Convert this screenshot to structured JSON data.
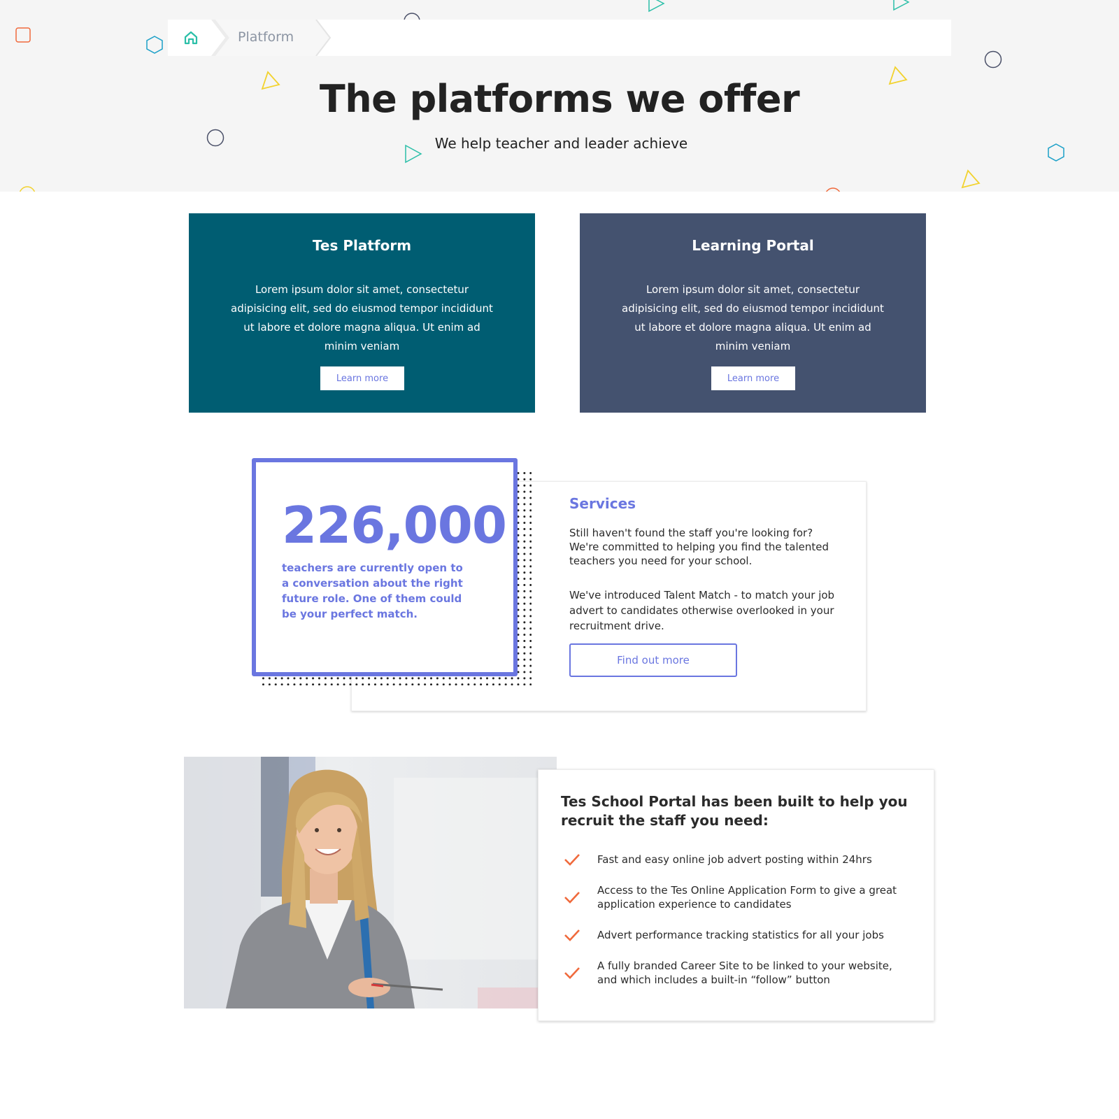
{
  "breadcrumb": {
    "home_icon": "home-icon",
    "current": "Platform"
  },
  "hero": {
    "title": "The platforms we offer",
    "subtitle": "We help teacher and leader achieve"
  },
  "platforms": [
    {
      "title": "Tes Platform",
      "description": "Lorem ipsum dolor sit amet, consectetur adipisicing elit, sed do eiusmod tempor incididunt ut labore et dolore magna aliqua. Ut enim ad minim veniam",
      "button": "Learn more",
      "color": "#005d72"
    },
    {
      "title": "Learning Portal",
      "description": "Lorem ipsum dolor sit amet, consectetur adipisicing elit, sed do eiusmod tempor incididunt ut labore et dolore magna aliqua. Ut enim ad minim veniam",
      "button": "Learn more",
      "color": "#44526f"
    }
  ],
  "stat": {
    "number": "226,000",
    "text": "teachers are currently open to a conversation about the right future role. One of them could be your perfect match."
  },
  "services": {
    "title": "Services",
    "paragraph1": "Still haven't found the staff you're looking for? We're committed to helping you find the talented teachers you need for your school.",
    "paragraph2": "We've introduced Talent Match - to match your job advert to candidates otherwise overlooked in your recruitment drive.",
    "button": "Find out more"
  },
  "features": {
    "title": "Tes School Portal has been built to help you recruit the staff you need:",
    "items": [
      "Fast and easy online job advert posting within 24hrs",
      "Access to the Tes Online Application Form to give a great application experience to candidates",
      "Advert performance tracking statistics for all your jobs",
      "A fully branded Career Site to be linked to your website, and which includes a built-in “follow” button"
    ],
    "check_icon": "check-icon"
  },
  "colors": {
    "accent": "#6a76e0",
    "teal": "#005d72",
    "slate": "#44526f",
    "check": "#f06a3c",
    "home": "#2bbfa8"
  }
}
